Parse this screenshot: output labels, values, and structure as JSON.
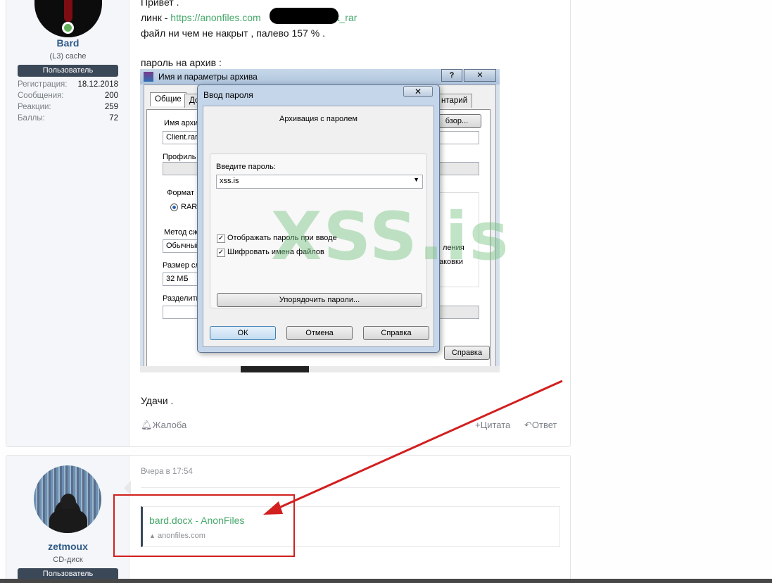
{
  "post1": {
    "user": {
      "name": "Bard",
      "title": "(L3) cache",
      "banner": "Пользователь",
      "stats": [
        {
          "label": "Регистрация:",
          "value": "18.12.2018"
        },
        {
          "label": "Сообщения:",
          "value": "200"
        },
        {
          "label": "Реакции:",
          "value": "259"
        },
        {
          "label": "Баллы:",
          "value": "72"
        }
      ]
    },
    "lines": {
      "greeting": "Привет .",
      "link_prefix": "линк - ",
      "link_start": "https://anonfiles.com",
      "link_end": "Client_rar",
      "note": "файл ни чем не накрыт , палево 157 % .",
      "password_label": "пароль на архив :",
      "closing": "Удачи ."
    },
    "actions": {
      "report": "Жалоба",
      "quote": "Цитата",
      "reply": "Ответ"
    }
  },
  "screenshot": {
    "window_title": "Имя и параметры архива",
    "help_btn": "?",
    "close_btn": "✕",
    "tabs": [
      "Общие",
      "До",
      "нтарий"
    ],
    "labels": {
      "archive_name": "Имя архив",
      "archive_value": "Client.rar",
      "browse": "бзор...",
      "profile": "Профиль п",
      "format": "Формат",
      "rar": "RAR",
      "method": "Метод сж",
      "method_value": "Обычный",
      "size": "Размер сл",
      "size_value": "32 МБ",
      "split": "Разделить",
      "right1": "ления",
      "right2": "аковки",
      "help": "Справка"
    },
    "dialog": {
      "title": "Ввод пароля",
      "close": "✕",
      "header": "Архивация с паролем",
      "enter_label": "Введите пароль:",
      "password_value": "xss.is",
      "show_password": "Отображать пароль при вводе",
      "encrypt_names": "Шифровать имена файлов",
      "organize": "Упорядочить пароли...",
      "ok": "ОК",
      "cancel": "Отмена",
      "help": "Справка"
    },
    "watermark": "XSS.is"
  },
  "post2": {
    "user": {
      "name": "zetmoux",
      "title": "CD-диск",
      "banner": "Пользователь"
    },
    "time": "Вчера в 17:54",
    "embed": {
      "title": "bard.docx - AnonFiles",
      "domain": "anonfiles.com"
    }
  },
  "colors": {
    "link": "#47a86b",
    "banner": "#3b4858",
    "annotation": "#d21f1f"
  }
}
